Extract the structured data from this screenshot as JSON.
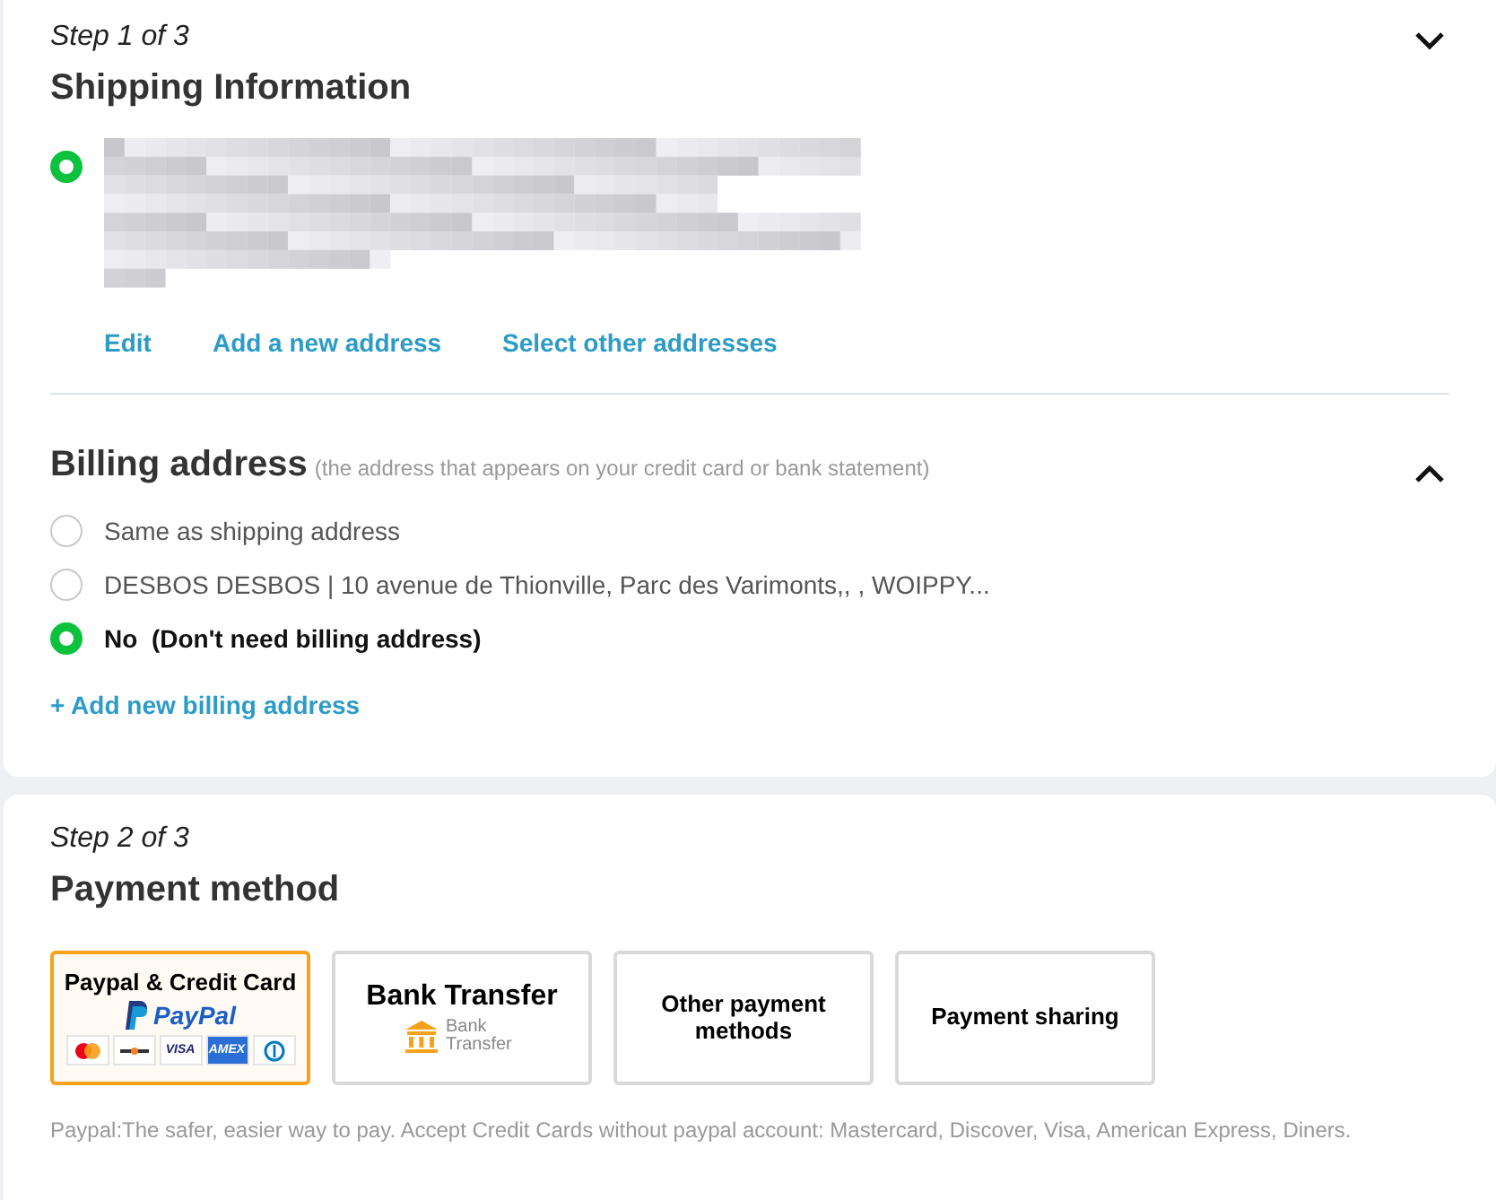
{
  "shipping": {
    "step": "Step 1 of 3",
    "title": "Shipping Information",
    "expanded": true,
    "address": {
      "selected": true
    },
    "links": [
      "Edit",
      "Add a new address",
      "Select other addresses"
    ]
  },
  "billing": {
    "title": "Billing address",
    "hint": "(the address that appears on your credit card or bank statement)",
    "expanded": true,
    "options": [
      {
        "label": "Same as shipping address",
        "selected": false
      },
      {
        "label": "DESBOS DESBOS | 10 avenue de Thionville, Parc des Varimonts,, , WOIPPY...",
        "selected": false
      },
      {
        "label": "No  (Don't need billing address)",
        "selected": true
      }
    ],
    "add_link": "+ Add new billing address"
  },
  "payment": {
    "step": "Step 2 of 3",
    "title": "Payment method",
    "methods": [
      {
        "kind": "paypal",
        "label": "Paypal & Credit Card",
        "logo_text": "PayPal",
        "cards": [
          {
            "kind": "mastercard"
          },
          {
            "kind": "discover"
          },
          {
            "kind": "visa",
            "label": "VISA"
          },
          {
            "kind": "amex",
            "label": "AMEX"
          },
          {
            "kind": "diners"
          }
        ],
        "selected": true
      },
      {
        "kind": "bank",
        "label": "Bank Transfer",
        "logo_text": "Bank Transfer",
        "selected": false
      },
      {
        "kind": "plain",
        "label": "Other payment methods",
        "selected": false
      },
      {
        "kind": "plain",
        "label": "Payment sharing",
        "selected": false
      }
    ],
    "note": "Paypal:The safer, easier way to pay. Accept Credit Cards without paypal account: Mastercard, Discover, Visa, American Express, Diners."
  }
}
